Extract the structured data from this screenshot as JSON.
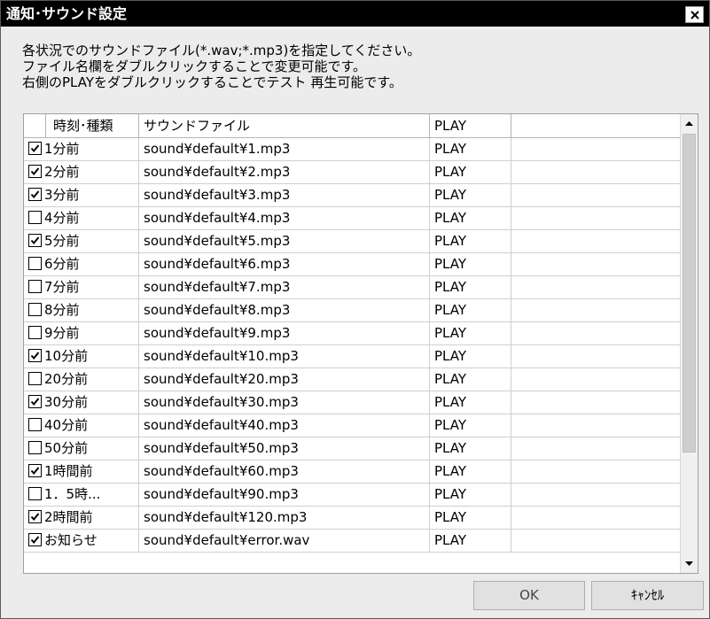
{
  "window": {
    "title": "通知･サウンド設定",
    "close_label": "×"
  },
  "instructions": [
    "各状況でのサウンドファイル(*.wav;*.mp3)を指定してください。",
    "ファイル名欄をダブルクリックすることで変更可能です。",
    "右側のPLAYをダブルクリックすることでテスト 再生可能です。"
  ],
  "columns": [
    "時刻･種類",
    "サウンドファイル",
    "PLAY",
    ""
  ],
  "rows": [
    {
      "checked": true,
      "label": "1分前",
      "file": "sound¥default¥1.mp3",
      "play": "PLAY"
    },
    {
      "checked": true,
      "label": "2分前",
      "file": "sound¥default¥2.mp3",
      "play": "PLAY"
    },
    {
      "checked": true,
      "label": "3分前",
      "file": "sound¥default¥3.mp3",
      "play": "PLAY"
    },
    {
      "checked": false,
      "label": "4分前",
      "file": "sound¥default¥4.mp3",
      "play": "PLAY"
    },
    {
      "checked": true,
      "label": "5分前",
      "file": "sound¥default¥5.mp3",
      "play": "PLAY"
    },
    {
      "checked": false,
      "label": "6分前",
      "file": "sound¥default¥6.mp3",
      "play": "PLAY"
    },
    {
      "checked": false,
      "label": "7分前",
      "file": "sound¥default¥7.mp3",
      "play": "PLAY"
    },
    {
      "checked": false,
      "label": "8分前",
      "file": "sound¥default¥8.mp3",
      "play": "PLAY"
    },
    {
      "checked": false,
      "label": "9分前",
      "file": "sound¥default¥9.mp3",
      "play": "PLAY"
    },
    {
      "checked": true,
      "label": "10分前",
      "file": "sound¥default¥10.mp3",
      "play": "PLAY"
    },
    {
      "checked": false,
      "label": "20分前",
      "file": "sound¥default¥20.mp3",
      "play": "PLAY"
    },
    {
      "checked": true,
      "label": "30分前",
      "file": "sound¥default¥30.mp3",
      "play": "PLAY"
    },
    {
      "checked": false,
      "label": "40分前",
      "file": "sound¥default¥40.mp3",
      "play": "PLAY"
    },
    {
      "checked": false,
      "label": "50分前",
      "file": "sound¥default¥50.mp3",
      "play": "PLAY"
    },
    {
      "checked": true,
      "label": "1時間前",
      "file": "sound¥default¥60.mp3",
      "play": "PLAY"
    },
    {
      "checked": false,
      "label": "1．5時...",
      "file": "sound¥default¥90.mp3",
      "play": "PLAY"
    },
    {
      "checked": true,
      "label": "2時間前",
      "file": "sound¥default¥120.mp3",
      "play": "PLAY"
    },
    {
      "checked": true,
      "label": "お知らせ",
      "file": "sound¥default¥error.wav",
      "play": "PLAY"
    }
  ],
  "buttons": {
    "ok": "OK",
    "cancel": "ｷｬﾝｾﾙ"
  },
  "colors": {
    "titlebar": "#000000",
    "window_bg": "#ececec",
    "list_bg": "#ffffff"
  }
}
